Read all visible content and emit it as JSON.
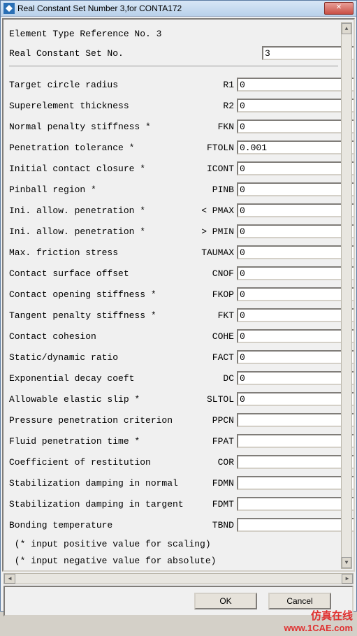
{
  "window": {
    "title": "Real Constant Set Number 3,for CONTA172",
    "close_glyph": "✕"
  },
  "header": {
    "ref_label": "Element Type Reference No. 3",
    "set_label": "Real Constant Set No.",
    "set_value": "3"
  },
  "rows": [
    {
      "label": "Target circle radius",
      "code": "R1",
      "value": "0"
    },
    {
      "label": "Superelement thickness",
      "code": "R2",
      "value": "0"
    },
    {
      "label": "Normal penalty stiffness *",
      "code": "FKN",
      "value": "0"
    },
    {
      "label": "Penetration tolerance *",
      "code": "FTOLN",
      "value": "0.001"
    },
    {
      "label": "Initial contact closure *",
      "code": "ICONT",
      "value": "0"
    },
    {
      "label": "Pinball region *",
      "code": "PINB",
      "value": "0"
    },
    {
      "label": "Ini. allow. penetration *",
      "code": "< PMAX",
      "value": "0"
    },
    {
      "label": "Ini. allow. penetration *",
      "code": "> PMIN",
      "value": "0"
    },
    {
      "label": "Max. friction stress",
      "code": "TAUMAX",
      "value": "0"
    },
    {
      "label": "Contact surface offset",
      "code": "CNOF",
      "value": "0"
    },
    {
      "label": "Contact opening stiffness *",
      "code": "FKOP",
      "value": "0"
    },
    {
      "label": "Tangent penalty stiffness *",
      "code": "FKT",
      "value": "0"
    },
    {
      "label": "Contact cohesion",
      "code": "COHE",
      "value": "0"
    },
    {
      "label": "Static/dynamic ratio",
      "code": "FACT",
      "value": "0"
    },
    {
      "label": "Exponential decay coeft",
      "code": "DC",
      "value": "0"
    },
    {
      "label": "Allowable elastic slip *",
      "code": "SLTOL",
      "value": "0"
    },
    {
      "label": "Pressure penetration criterion",
      "code": "PPCN",
      "value": ""
    },
    {
      "label": "Fluid penetration time *",
      "code": "FPAT",
      "value": ""
    },
    {
      "label": "Coefficient of restitution",
      "code": "COR",
      "value": ""
    },
    {
      "label": "Stabilization damping in normal",
      "code": "FDMN",
      "value": ""
    },
    {
      "label": "Stabilization damping in targent",
      "code": "FDMT",
      "value": ""
    },
    {
      "label": "Bonding temperature",
      "code": "TBND",
      "value": ""
    }
  ],
  "notes": {
    "n1": " (* input positive value for scaling)",
    "n2": " (* input negative value for absolute)"
  },
  "buttons": {
    "ok": "OK",
    "cancel": "Cancel"
  },
  "watermark": {
    "line1": "仿真在线",
    "line2": "www.1CAE.com"
  }
}
